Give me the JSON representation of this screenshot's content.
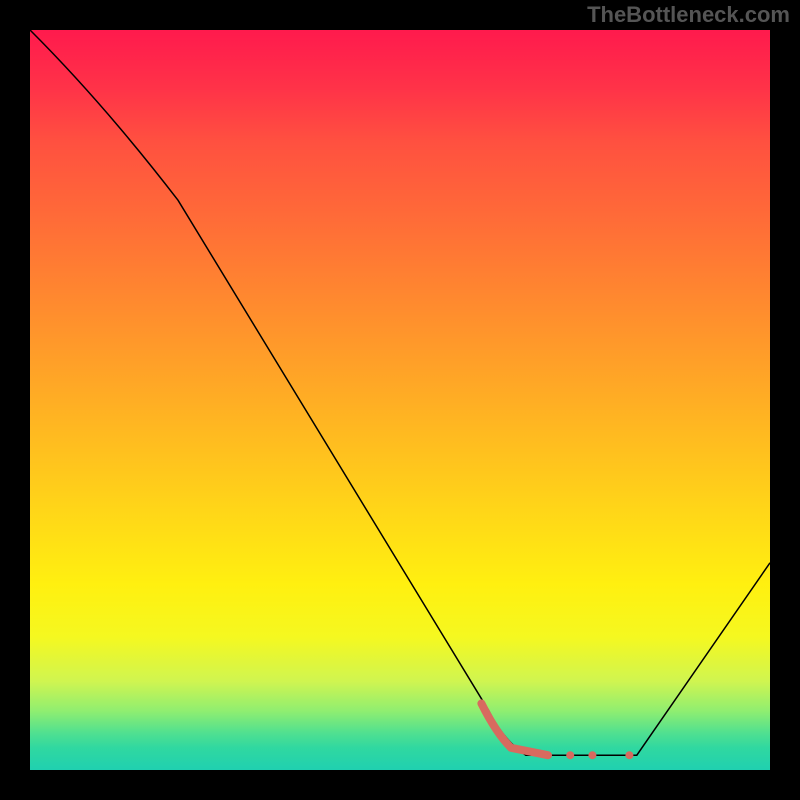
{
  "watermark": "TheBottleneck.com",
  "chart_data": {
    "type": "line",
    "title": "",
    "xlabel": "",
    "ylabel": "",
    "xlim": [
      0,
      100
    ],
    "ylim": [
      0,
      100
    ],
    "series": [
      {
        "name": "curve",
        "color": "#000000",
        "width": 1.5,
        "points": [
          {
            "x": 0,
            "y": 100
          },
          {
            "x": 20,
            "y": 77
          },
          {
            "x": 62,
            "y": 8
          },
          {
            "x": 67,
            "y": 2
          },
          {
            "x": 82,
            "y": 2
          },
          {
            "x": 100,
            "y": 28
          }
        ]
      },
      {
        "name": "highlight-segment",
        "color": "#d86a5f",
        "width": 8,
        "points": [
          {
            "x": 61,
            "y": 9
          },
          {
            "x": 65,
            "y": 3
          },
          {
            "x": 70,
            "y": 2
          }
        ]
      }
    ],
    "dots": {
      "color": "#d86a5f",
      "radius": 4,
      "points": [
        {
          "x": 73,
          "y": 2
        },
        {
          "x": 76,
          "y": 2
        },
        {
          "x": 81,
          "y": 2
        }
      ]
    }
  }
}
